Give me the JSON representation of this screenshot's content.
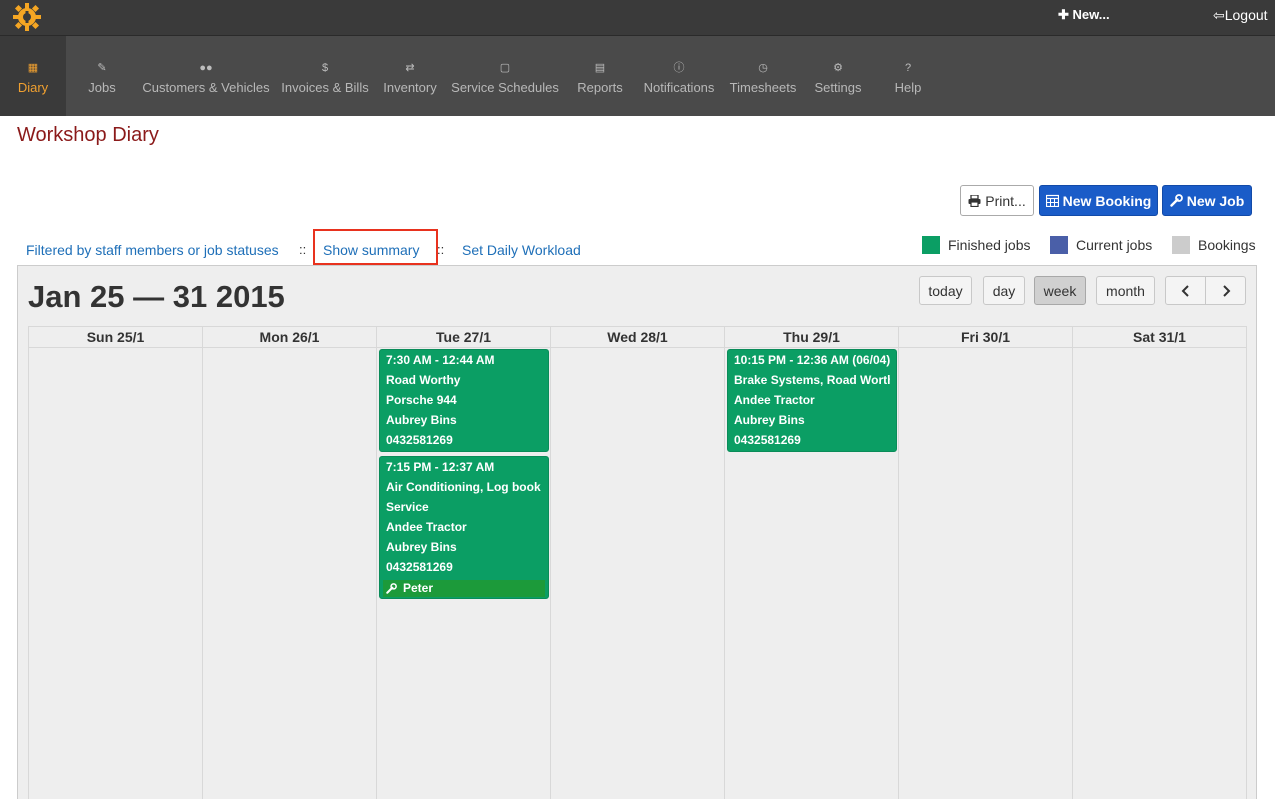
{
  "topbar": {
    "new_label": "New...",
    "logout_label": "Logout"
  },
  "nav": {
    "items": [
      {
        "label": "Diary",
        "icon": "calendar-icon"
      },
      {
        "label": "Jobs",
        "icon": "wrench-icon"
      },
      {
        "label": "Customers & Vehicles",
        "icon": "users-icon"
      },
      {
        "label": "Invoices & Bills",
        "icon": "dollar-icon"
      },
      {
        "label": "Inventory",
        "icon": "exchange-icon"
      },
      {
        "label": "Service Schedules",
        "icon": "calendar-icon"
      },
      {
        "label": "Reports",
        "icon": "chart-icon"
      },
      {
        "label": "Notifications",
        "icon": "info-icon"
      },
      {
        "label": "Timesheets",
        "icon": "clock-icon"
      },
      {
        "label": "Settings",
        "icon": "cogs-icon"
      },
      {
        "label": "Help",
        "icon": "question-icon"
      }
    ]
  },
  "page": {
    "title": "Workshop Diary"
  },
  "actions": {
    "print": "Print...",
    "new_booking": "New Booking",
    "new_job": "New Job"
  },
  "filters": {
    "staff_filter": "Filtered by staff members or job statuses",
    "separator": "::",
    "show_summary": "Show summary",
    "set_workload": "Set Daily Workload"
  },
  "legend": {
    "finished": {
      "label": "Finished jobs",
      "color": "#0b9e64"
    },
    "current": {
      "label": "Current jobs",
      "color": "#4a5fa8"
    },
    "bookings": {
      "label": "Bookings",
      "color": "#cccccc"
    }
  },
  "calendar": {
    "title": "Jan 25 — 31 2015",
    "views": {
      "today": "today",
      "day": "day",
      "week": "week",
      "month": "month"
    },
    "active_view": "week",
    "days": [
      "Sun 25/1",
      "Mon 26/1",
      "Tue 27/1",
      "Wed 28/1",
      "Thu 29/1",
      "Fri 30/1",
      "Sat 31/1"
    ],
    "events": [
      {
        "day": "Tue 27/1",
        "lines": [
          "7:30 AM - 12:44 AM",
          "Road Worthy",
          "Porsche 944",
          "Aubrey Bins",
          "0432581269"
        ],
        "staff": ""
      },
      {
        "day": "Tue 27/1",
        "lines": [
          "7:15 PM - 12:37 AM",
          "Air Conditioning, Log book",
          "Service",
          "Andee Tractor",
          "Aubrey Bins",
          "0432581269"
        ],
        "staff": "Peter"
      },
      {
        "day": "Thu 29/1",
        "lines": [
          "10:15 PM - 12:36 AM (06/04)",
          "Brake Systems, Road Worthy",
          "Andee Tractor",
          "Aubrey Bins",
          "0432581269"
        ],
        "staff": ""
      }
    ]
  }
}
